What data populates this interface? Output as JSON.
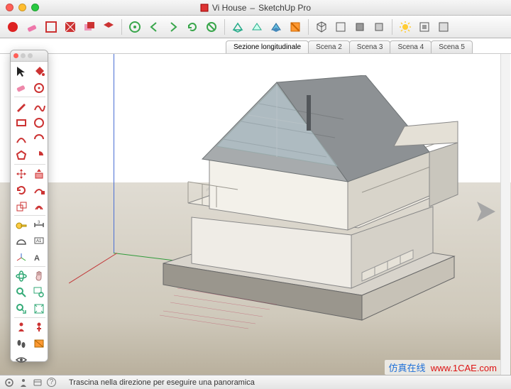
{
  "window": {
    "title_doc": "Vi House",
    "title_app": "SketchUp Pro"
  },
  "scenes": {
    "tabs": [
      {
        "label": "Sezione longitudinale",
        "active": true
      },
      {
        "label": "Scena 2",
        "active": false
      },
      {
        "label": "Scena 3",
        "active": false
      },
      {
        "label": "Scena 4",
        "active": false
      },
      {
        "label": "Scena 5",
        "active": false
      }
    ]
  },
  "status": {
    "hint": "Trascina nella direzione per eseguire una panoramica"
  },
  "watermark": {
    "brand_cn": "仿真在线",
    "brand_url": "www.1CAE.com",
    "bg_text": "1CAE"
  },
  "topbar_tools": [
    "addon-red",
    "eraser",
    "box-red",
    "hatch",
    "duplicate",
    "plane",
    "nav-home",
    "back",
    "forward",
    "reload",
    "stop",
    "dimension-green",
    "angle-green",
    "guide-blue",
    "section-orange",
    "pan",
    "orbit",
    "zoom",
    "zoom-extents",
    "layers",
    "shadow",
    "wire"
  ],
  "palette_tools": [
    [
      "select",
      "paint"
    ],
    [
      "eraser",
      "snap-red"
    ],
    [
      "line-red",
      "freehand-red"
    ],
    [
      "rectangle",
      "circle"
    ],
    [
      "arc",
      "arc2"
    ],
    [
      "polygon",
      "pie"
    ],
    [
      "move",
      "pushpull"
    ],
    [
      "rotate",
      "followme"
    ],
    [
      "scale",
      "offset"
    ],
    [
      "tape",
      "dimension"
    ],
    [
      "protractor",
      "text"
    ],
    [
      "axes",
      "3dtext"
    ],
    [
      "orbit",
      "pan"
    ],
    [
      "zoom",
      "zoom-window"
    ],
    [
      "prev",
      "zoom-extents"
    ],
    [
      "position",
      "look"
    ],
    [
      "walk",
      "section"
    ],
    [
      "eye",
      "blank"
    ]
  ]
}
